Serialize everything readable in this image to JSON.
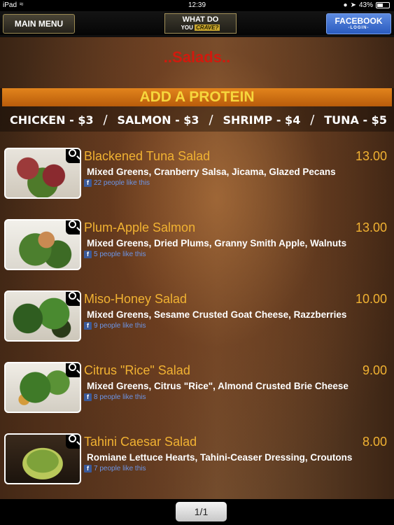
{
  "status": {
    "carrier": "iPad",
    "time": "12:39",
    "battery": "43%"
  },
  "nav": {
    "main_menu": "MAIN MENU",
    "crave_line1": "WHAT DO",
    "crave_you": "YOU",
    "crave_word": "CRAVE?",
    "facebook": "FACEBOOK",
    "facebook_sub": "-LOGIN-"
  },
  "section": {
    "title": "..Salads.."
  },
  "protein": {
    "header": "ADD A PROTEIN",
    "options": [
      "CHICKEN - $3",
      "SALMON - $3",
      "SHRIMP - $4",
      "TUNA - $5"
    ],
    "separator": "/"
  },
  "items": [
    {
      "name": "Blackened Tuna Salad",
      "price": "13.00",
      "desc": "Mixed Greens, Cranberry Salsa, Jicama, Glazed Pecans",
      "likes": "22 people like this"
    },
    {
      "name": "Plum-Apple Salmon",
      "price": "13.00",
      "desc": "Mixed Greens, Dried Plums, Granny Smith Apple, Walnuts",
      "likes": "5 people like this"
    },
    {
      "name": "Miso-Honey Salad",
      "price": "10.00",
      "desc": "Mixed Greens, Sesame Crusted Goat Cheese, Razzberries",
      "likes": "9 people like this"
    },
    {
      "name": "Citrus \"Rice\" Salad",
      "price": "9.00",
      "desc": "Mixed Greens, Citrus \"Rice\", Almond Crusted Brie Cheese",
      "likes": "8 people like this"
    },
    {
      "name": "Tahini Caesar Salad",
      "price": "8.00",
      "desc": "Romiane Lettuce Hearts, Tahini-Ceaser Dressing, Croutons",
      "likes": "7 people like this"
    }
  ],
  "pager": {
    "label": "1/1"
  }
}
